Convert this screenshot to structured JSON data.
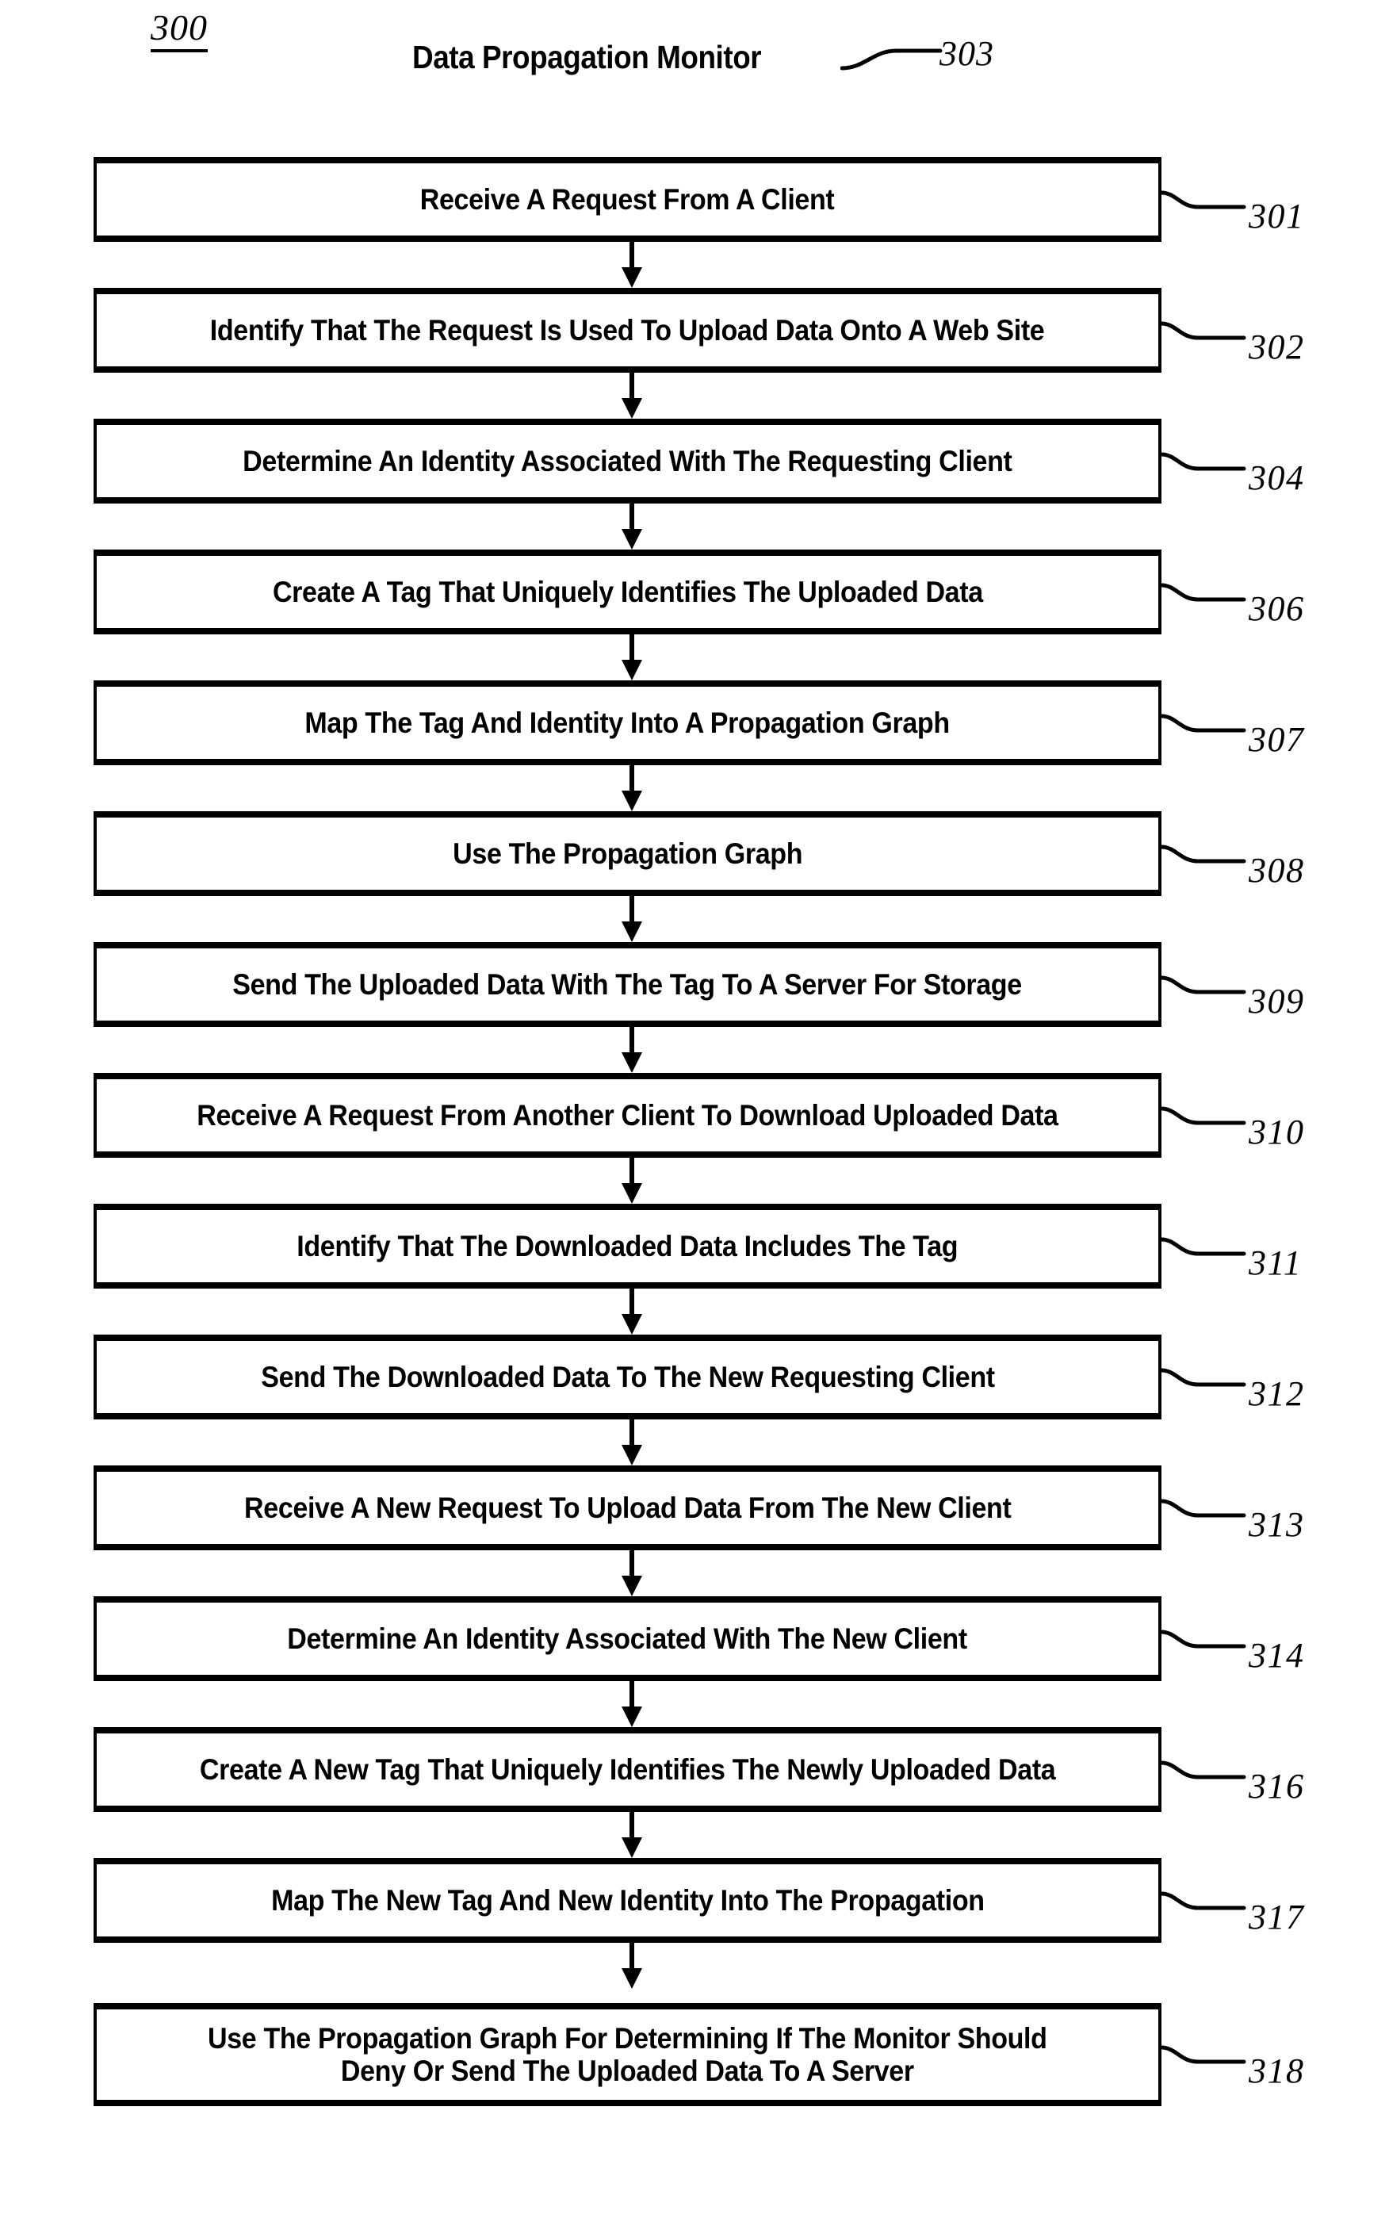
{
  "figure": {
    "number": "300",
    "title": "Data Propagation Monitor",
    "title_ref": "303"
  },
  "flowchart": {
    "type": "flowchart",
    "orientation": "vertical",
    "steps": [
      {
        "ref": "301",
        "text": "Receive A Request From A Client"
      },
      {
        "ref": "302",
        "text": "Identify That The Request Is Used To Upload Data Onto A Web Site"
      },
      {
        "ref": "304",
        "text": "Determine An Identity Associated With The Requesting Client"
      },
      {
        "ref": "306",
        "text": "Create A Tag That Uniquely Identifies The Uploaded Data"
      },
      {
        "ref": "307",
        "text": "Map The Tag And Identity Into A Propagation Graph"
      },
      {
        "ref": "308",
        "text": "Use The Propagation Graph"
      },
      {
        "ref": "309",
        "text": "Send The Uploaded Data With The Tag To A Server For Storage"
      },
      {
        "ref": "310",
        "text": "Receive A Request From Another Client To Download Uploaded Data"
      },
      {
        "ref": "311",
        "text": "Identify That The Downloaded Data Includes The Tag"
      },
      {
        "ref": "312",
        "text": "Send The Downloaded Data To The New Requesting Client"
      },
      {
        "ref": "313",
        "text": "Receive A New Request To Upload Data From The New Client"
      },
      {
        "ref": "314",
        "text": "Determine An Identity Associated With The New Client"
      },
      {
        "ref": "316",
        "text": "Create A New Tag That Uniquely Identifies The Newly Uploaded Data"
      },
      {
        "ref": "317",
        "text": "Map The New Tag And New Identity Into The Propagation"
      },
      {
        "ref": "318",
        "text": "Use The Propagation Graph For Determining If The Monitor Should\nDeny Or Send The Uploaded Data To A Server"
      }
    ]
  },
  "colors": {
    "stroke": "#000000",
    "background": "#ffffff"
  }
}
